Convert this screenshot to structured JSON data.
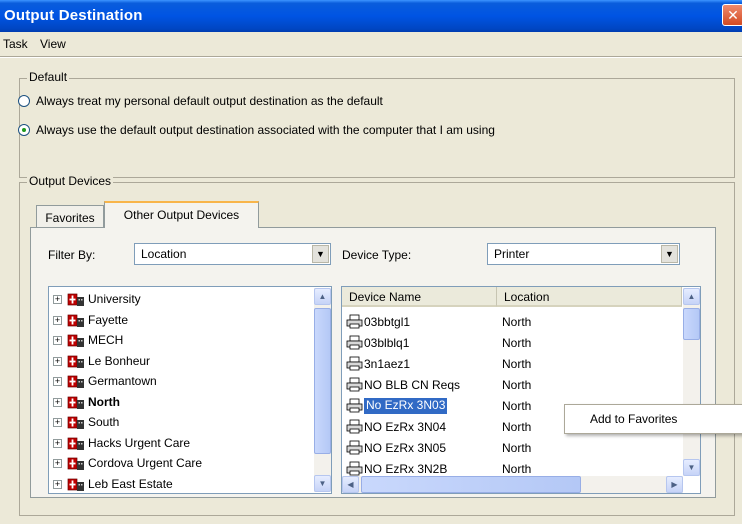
{
  "window": {
    "title": "Output Destination",
    "close_glyph": "✕"
  },
  "menu": [
    "Task",
    "View"
  ],
  "default_group": {
    "label": "Default",
    "options": [
      {
        "label": "Always treat my personal default output destination as the default",
        "selected": false
      },
      {
        "label": "Always use the default output destination associated with the computer that I am using",
        "selected": true
      }
    ]
  },
  "devices_group": {
    "label": "Output Devices",
    "tabs": [
      {
        "label": "Favorites",
        "active": false
      },
      {
        "label": "Other Output Devices",
        "active": true
      }
    ],
    "filter_label": "Filter By:",
    "filter_value": "Location",
    "device_type_label": "Device Type:",
    "device_type_value": "Printer",
    "locations": [
      {
        "label": "University",
        "bold": false
      },
      {
        "label": "Fayette",
        "bold": false
      },
      {
        "label": "MECH",
        "bold": false
      },
      {
        "label": "Le Bonheur",
        "bold": false
      },
      {
        "label": "Germantown",
        "bold": false
      },
      {
        "label": "North",
        "bold": true
      },
      {
        "label": "South",
        "bold": false
      },
      {
        "label": "Hacks Urgent Care",
        "bold": false
      },
      {
        "label": "Cordova Urgent Care",
        "bold": false
      },
      {
        "label": "Leb East Estate",
        "bold": false
      }
    ],
    "columns": [
      "Device Name",
      "Location"
    ],
    "devices": [
      {
        "name": "03bbtgl1",
        "location": "North",
        "selected": false
      },
      {
        "name": "03blblq1",
        "location": "North",
        "selected": false
      },
      {
        "name": "3n1aez1",
        "location": "North",
        "selected": false
      },
      {
        "name": "NO BLB CN Reqs",
        "location": "North",
        "selected": false
      },
      {
        "name": "No EzRx 3N03",
        "location": "North",
        "selected": true
      },
      {
        "name": "NO EzRx 3N04",
        "location": "North",
        "selected": false
      },
      {
        "name": "NO EzRx 3N05",
        "location": "North",
        "selected": false
      },
      {
        "name": "NO EzRx 3N2B",
        "location": "North",
        "selected": false
      }
    ]
  },
  "context_menu": {
    "item": "Add to Favorites"
  },
  "icons": {
    "location": "hospital-cross-icon",
    "device": "printer-icon"
  },
  "colors": {
    "titlebar": "#0054e3",
    "selection": "#316ac5",
    "window_bg": "#ece9d8"
  }
}
